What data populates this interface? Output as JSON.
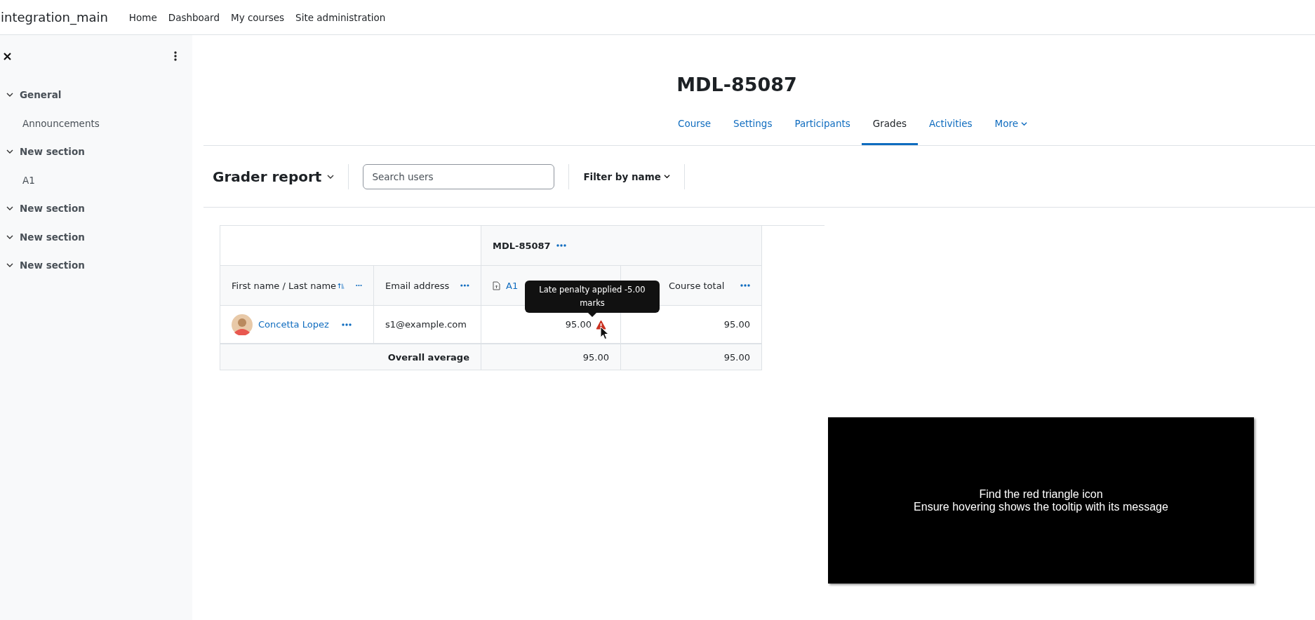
{
  "navbar": {
    "brand": "integration_main",
    "links": [
      "Home",
      "Dashboard",
      "My courses",
      "Site administration"
    ]
  },
  "sidebar": {
    "items": [
      {
        "label": "General",
        "kind": "section",
        "expanded": true
      },
      {
        "label": "Announcements",
        "kind": "activity"
      },
      {
        "label": "New section",
        "kind": "section",
        "expanded": true
      },
      {
        "label": "A1",
        "kind": "activity"
      },
      {
        "label": "New section",
        "kind": "section",
        "expanded": true
      },
      {
        "label": "New section",
        "kind": "section",
        "expanded": true
      },
      {
        "label": "New section",
        "kind": "section",
        "expanded": true
      }
    ]
  },
  "page": {
    "title": "MDL-85087",
    "tabs": [
      {
        "label": "Course",
        "selected": false,
        "kind": "link"
      },
      {
        "label": "Settings",
        "selected": false,
        "kind": "link"
      },
      {
        "label": "Participants",
        "selected": false,
        "kind": "link"
      },
      {
        "label": "Grades",
        "selected": true,
        "kind": "link"
      },
      {
        "label": "Activities",
        "selected": false,
        "kind": "link"
      },
      {
        "label": "More",
        "selected": false,
        "kind": "menu"
      }
    ]
  },
  "toolbar": {
    "report_selector": "Grader report",
    "search": {
      "placeholder": "Search users"
    },
    "filter": "Filter by name"
  },
  "grader_table": {
    "category": "MDL-85087",
    "columns": [
      {
        "label": "First name / Last name",
        "kind": "name",
        "sorted": true,
        "menu": true
      },
      {
        "label": "Email address",
        "kind": "email",
        "sorted": false,
        "menu": true
      },
      {
        "label": "A1",
        "kind": "assignment",
        "sorted": false,
        "menu": false
      },
      {
        "label": "Course total",
        "kind": "total",
        "sorted": false,
        "menu": true
      }
    ],
    "rows": [
      {
        "name": "Concetta Lopez",
        "email": "s1@example.com",
        "grade": "95.00",
        "penalty": true,
        "total": "95.00"
      }
    ],
    "average": {
      "label": "Overall average",
      "values": [
        "95.00",
        "95.00"
      ]
    }
  },
  "tooltip": {
    "text": "Late penalty applied -5.00 marks"
  },
  "overlay": {
    "lines": [
      "Find the red triangle icon",
      "Ensure hovering shows the tooltip with its message"
    ]
  }
}
